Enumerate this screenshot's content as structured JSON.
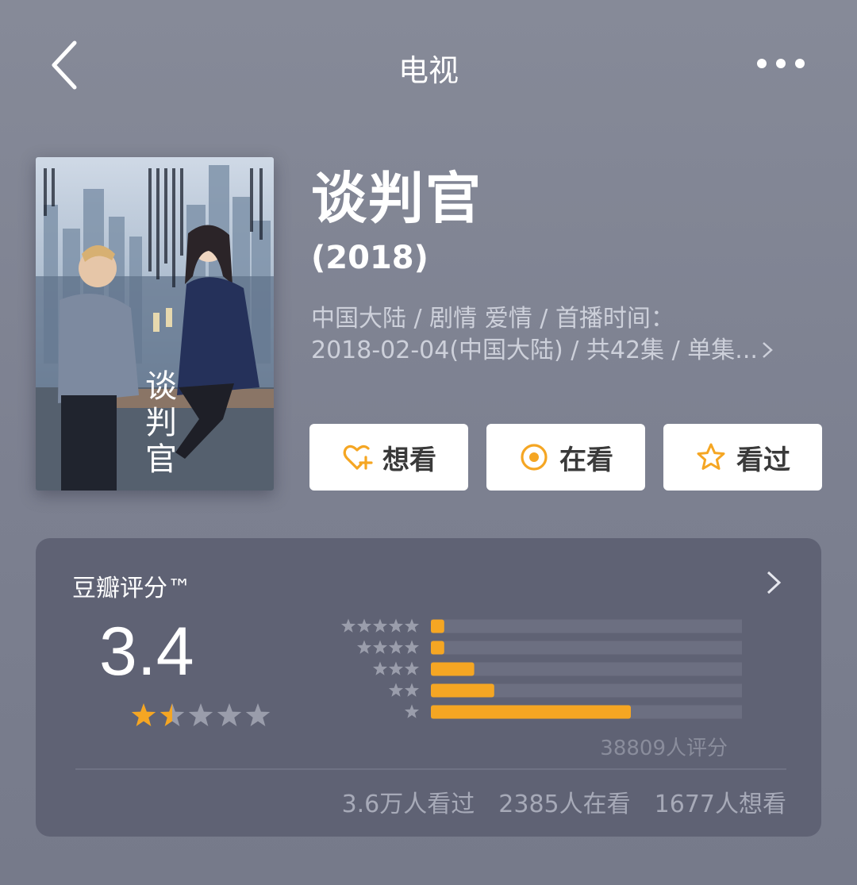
{
  "nav": {
    "title": "电视",
    "back_icon": "chevron-left-icon",
    "more_icon": "more-dots-icon"
  },
  "poster": {
    "title_text": "谈判官"
  },
  "show": {
    "title": "谈判官",
    "year": "(2018)",
    "meta_line1": "中国大陆 / 剧情 爱情 / 首播时间：",
    "meta_line2": "2018-02-04(中国大陆) / 共42集 / 单集...",
    "meta_more_icon": "chevron-right-icon"
  },
  "actions": [
    {
      "label": "想看",
      "icon": "heart-plus-icon"
    },
    {
      "label": "在看",
      "icon": "target-circle-icon"
    },
    {
      "label": "看过",
      "icon": "star-outline-icon"
    }
  ],
  "rating": {
    "title": "豆瓣评分™",
    "score": "3.4",
    "stars_filled": 1.5,
    "stars_total": 5,
    "distribution": [
      {
        "stars": 5,
        "fraction": 0.04
      },
      {
        "stars": 4,
        "fraction": 0.04
      },
      {
        "stars": 3,
        "fraction": 0.13
      },
      {
        "stars": 2,
        "fraction": 0.19
      },
      {
        "stars": 1,
        "fraction": 0.6
      }
    ],
    "rated_count": "38809人评分",
    "watched": "3.6万人看过",
    "watching": "2385人在看",
    "want": "1677人想看"
  },
  "colors": {
    "accent": "#f5a623",
    "star_gray": "#9a9dab",
    "track": "#6c6f81"
  }
}
